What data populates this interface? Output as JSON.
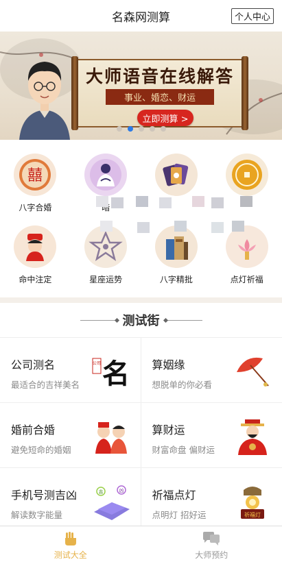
{
  "header": {
    "title": "名森网测算",
    "user_center": "个人中心"
  },
  "banner": {
    "headline": "大师语音在线解答",
    "subline": "事业、婚恋、财运",
    "cta": "立即测算 >",
    "slides": 5,
    "active_slide": 2
  },
  "grid": [
    {
      "label": "八字合婚",
      "icon": "double-happiness-icon"
    },
    {
      "label": "暗",
      "icon": "sad-person-icon"
    },
    {
      "label": "",
      "icon": "tarot-cards-icon"
    },
    {
      "label": "",
      "icon": "gold-coin-icon"
    },
    {
      "label": "命中注定",
      "icon": "bride-icon"
    },
    {
      "label": "星座运势",
      "icon": "star-icon"
    },
    {
      "label": "八字精批",
      "icon": "books-icon"
    },
    {
      "label": "点灯祈福",
      "icon": "lotus-lamp-icon"
    }
  ],
  "section": {
    "title": "测试街"
  },
  "cards": [
    {
      "title": "公司测名",
      "subtitle": "最适合的吉祥美名",
      "icon": "calligraphy-name-icon",
      "art_char": "名",
      "seal": "公司"
    },
    {
      "title": "算姻缘",
      "subtitle": "想脱单的你必看",
      "icon": "red-umbrella-icon"
    },
    {
      "title": "婚前合婚",
      "subtitle": "避免短命的婚姻",
      "icon": "couple-icon"
    },
    {
      "title": "算财运",
      "subtitle": "财富命盘 偏财运",
      "icon": "god-of-wealth-icon"
    },
    {
      "title": "手机号测吉凶",
      "subtitle": "解读数字能量",
      "icon": "phone-number-icon",
      "badges": [
        "吉",
        "凶"
      ]
    },
    {
      "title": "祈福点灯",
      "subtitle": "点明灯 招好运",
      "icon": "blessing-lamp-icon",
      "lamp_text": "祈福灯"
    }
  ],
  "tabbar": [
    {
      "label": "测试大全",
      "icon": "hand-icon",
      "active": true
    },
    {
      "label": "大师预约",
      "icon": "chat-bubbles-icon",
      "active": false
    }
  ],
  "colors": {
    "accent": "#e6b24a",
    "cta": "#d7261f",
    "dot_active": "#2d7be5"
  }
}
